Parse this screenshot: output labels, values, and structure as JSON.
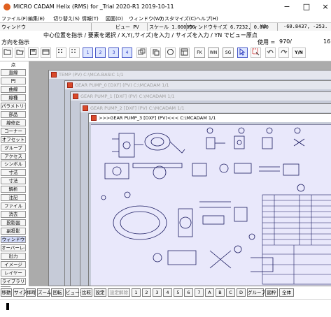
{
  "window": {
    "title": "MICRO CADAM Helix (RMS) for _Trial 2020-R1 2019-10-11",
    "minimize_glyph": "−",
    "maximize_glyph": "□",
    "close_glyph": "×"
  },
  "menu": [
    "ファイル(F)",
    "編集(E)",
    "切り替え(S)",
    "情報(T)",
    "図面(D)",
    "ウィンドウ(W)",
    "カスタマイズ(C)",
    "ヘルプ(H)"
  ],
  "info": {
    "window_label": "ウィンドウ",
    "view": "ビュー PV",
    "scale": "スケール 1.000000",
    "window_size": "ウィンドウサイズ 6.7232, 0.000",
    "layer": "V3",
    "coords": "-60.8437, -253."
  },
  "message": {
    "line1": "中心位置を指示 / 要素を選択 / X,Y(,サイズ)を入力 / サイズを入力 / YN でビュー原点",
    "line2": "方向を指示",
    "usage_label": "使用 =",
    "usage_value": "970/",
    "usage_total": "16"
  },
  "toolbar": {
    "fk": "FK",
    "wn": "WN",
    "sg": "SG",
    "yn": "Y/N"
  },
  "sidebar": {
    "top_label": "点",
    "items": [
      "直線",
      "円",
      "曲線",
      "線種",
      "パラメトリック",
      "部品",
      "線修正",
      "コーナー",
      "オフセット",
      "グループ",
      "アクセス",
      "シンボル",
      "寸法",
      "寸法",
      "解析",
      "注記",
      "ファイル",
      "消去",
      "投影図",
      "副投影",
      "ウィンドウ",
      "オーバーレイ",
      "出力",
      "イメージ",
      "レイヤー",
      "ライブラリ"
    ],
    "active_index": 20,
    "bottom_arrow": "<"
  },
  "windows": [
    {
      "title": "TEMP        (PV)  C:\\MCA.BASIC   1/1"
    },
    {
      "title": "GEAR PUMP_0     [DXF]  (PV)  C:\\MCADAM    1/1"
    },
    {
      "title": "GEAR PUMP_1     [DXF]  (PV)  C:\\MCADAM    1/1"
    },
    {
      "title": "GEAR PUMP_2     [DXF]  (PV)  C:\\MCADAM    1/1"
    },
    {
      "title": ">>>GEAR PUMP_3     [DXF]  (PV)<<<  C:\\MCADAM    1/1"
    }
  ],
  "footer": [
    "移動",
    "サイズ",
    "拝時",
    "ズーム",
    "回転",
    "ビューー",
    "比較",
    "設定",
    "設定解除",
    "1",
    "2",
    "3",
    "4",
    "5",
    "6",
    "7",
    "A",
    "B",
    "C",
    "D",
    "グループ",
    "図枠",
    "全体"
  ]
}
